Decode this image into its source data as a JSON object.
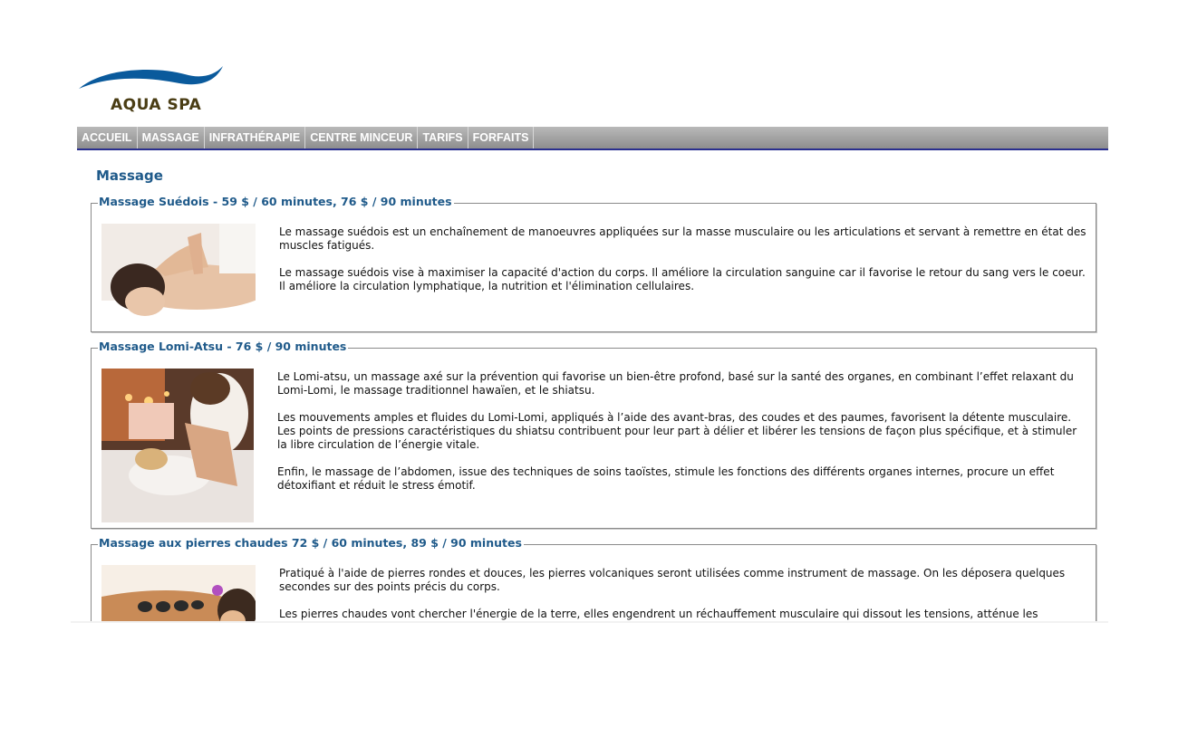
{
  "brand": {
    "name": "AQUA SPA",
    "wave_color": "#0a5a9c",
    "text_color": "#4a3d14"
  },
  "nav": {
    "items": [
      {
        "label": "ACCUEIL"
      },
      {
        "label": "MASSAGE"
      },
      {
        "label": "INFRATHÉRAPIE"
      },
      {
        "label": "CENTRE MINCEUR"
      },
      {
        "label": "TARIFS"
      },
      {
        "label": "FORFAITS"
      }
    ]
  },
  "main": {
    "title": "Massage",
    "sections": [
      {
        "legend": "Massage Suédois - 59 $ / 60 minutes, 76 $ / 90 minutes",
        "image_icon": "back-massage-photo",
        "paragraphs": [
          "Le massage suédois est un enchaînement de manoeuvres appliquées sur la masse musculaire ou les articulations et servant à remettre en état des muscles fatigués.",
          "Le massage suédois vise à maximiser la capacité d'action du corps. Il améliore la circulation sanguine car il favorise le retour du sang vers le coeur. Il améliore la circulation lymphatique, la nutrition et l'élimination cellulaires."
        ]
      },
      {
        "legend": "Massage Lomi-Atsu - 76 $ / 90 minutes",
        "image_icon": "lomi-massage-photo",
        "paragraphs": [
          "Le Lomi-atsu, un massage axé sur la prévention qui favorise un bien-être profond, basé sur la santé des organes, en combinant l’effet relaxant du Lomi-Lomi, le massage traditionnel hawaïen, et le shiatsu.",
          "Les mouvements amples et fluides du Lomi-Lomi, appliqués à l’aide des avant-bras, des coudes et des paumes, favorisent la détente musculaire. Les points de pressions caractéristiques du shiatsu contribuent pour leur part à délier et libérer les tensions de façon plus spécifique, et à stimuler la libre circulation de l’énergie vitale.",
          "Enfin, le massage de l’abdomen, issue des techniques de soins taoïstes, stimule les fonctions des différents organes internes, procure un effet détoxifiant et réduit le stress émotif."
        ]
      },
      {
        "legend": "Massage aux pierres chaudes 72 $ / 60 minutes, 89 $ / 90 minutes",
        "image_icon": "hot-stones-photo",
        "paragraphs": [
          "Pratiqué à l'aide de pierres rondes et douces, les pierres volcaniques seront utilisées comme instrument de massage. On les déposera quelques secondes sur des points précis du corps.",
          "Les pierres chaudes vont chercher l'énergie de la terre, elles engendrent un réchauffement musculaire qui dissout les tensions, atténue les douleurs et améliore la circulation sanguine."
        ]
      }
    ]
  },
  "colors": {
    "title": "#1f5a8a",
    "nav_underline": "#2a2f8f"
  }
}
